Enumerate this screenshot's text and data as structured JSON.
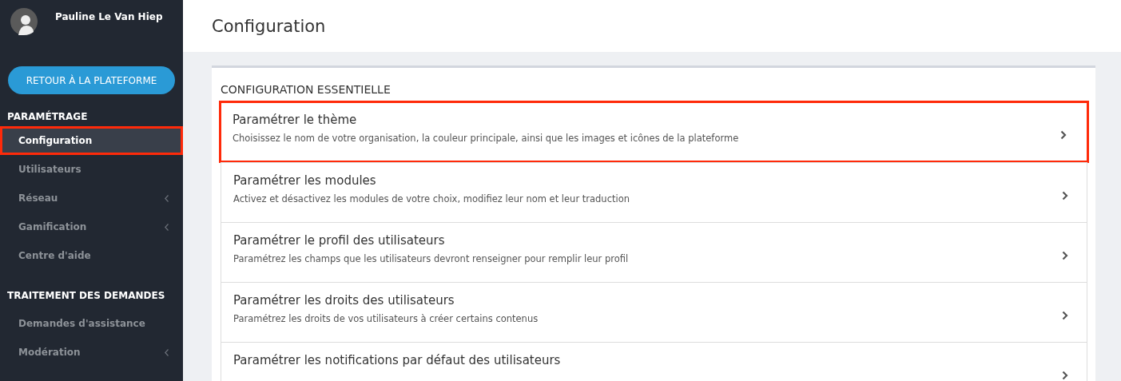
{
  "user": {
    "name": "Pauline Le Van Hiep"
  },
  "back_button": {
    "label": "RETOUR À LA PLATEFORME"
  },
  "sidebar": {
    "sections": [
      {
        "title": "PARAMÉTRAGE",
        "items": [
          {
            "label": "Configuration",
            "selected": true,
            "expandable": false,
            "highlighted": true
          },
          {
            "label": "Utilisateurs",
            "selected": false,
            "expandable": false,
            "highlighted": false
          },
          {
            "label": "Réseau",
            "selected": false,
            "expandable": true,
            "highlighted": false
          },
          {
            "label": "Gamification",
            "selected": false,
            "expandable": true,
            "highlighted": false
          },
          {
            "label": "Centre d'aide",
            "selected": false,
            "expandable": false,
            "highlighted": false
          }
        ]
      },
      {
        "title": "TRAITEMENT DES DEMANDES",
        "items": [
          {
            "label": "Demandes d'assistance",
            "selected": false,
            "expandable": false,
            "highlighted": false
          },
          {
            "label": "Modération",
            "selected": false,
            "expandable": true,
            "highlighted": false
          }
        ]
      }
    ]
  },
  "page": {
    "title": "Configuration"
  },
  "section": {
    "title": "CONFIGURATION ESSENTIELLE",
    "items": [
      {
        "title": "Paramétrer le thème",
        "description": "Choisissez le nom de votre organisation, la couleur principale, ainsi que les images et icônes de la plateforme",
        "highlighted": true
      },
      {
        "title": "Paramétrer les modules",
        "description": "Activez et désactivez les modules de votre choix, modifiez leur nom et leur traduction",
        "highlighted": false
      },
      {
        "title": "Paramétrer le profil des utilisateurs",
        "description": "Paramétrez les champs que les utilisateurs devront renseigner pour remplir leur profil",
        "highlighted": false
      },
      {
        "title": "Paramétrer les droits des utilisateurs",
        "description": "Paramétrez les droits de vos utilisateurs à créer certains contenus",
        "highlighted": false
      },
      {
        "title": "Paramétrer les notifications par défaut des utilisateurs",
        "highlighted": false
      }
    ]
  }
}
